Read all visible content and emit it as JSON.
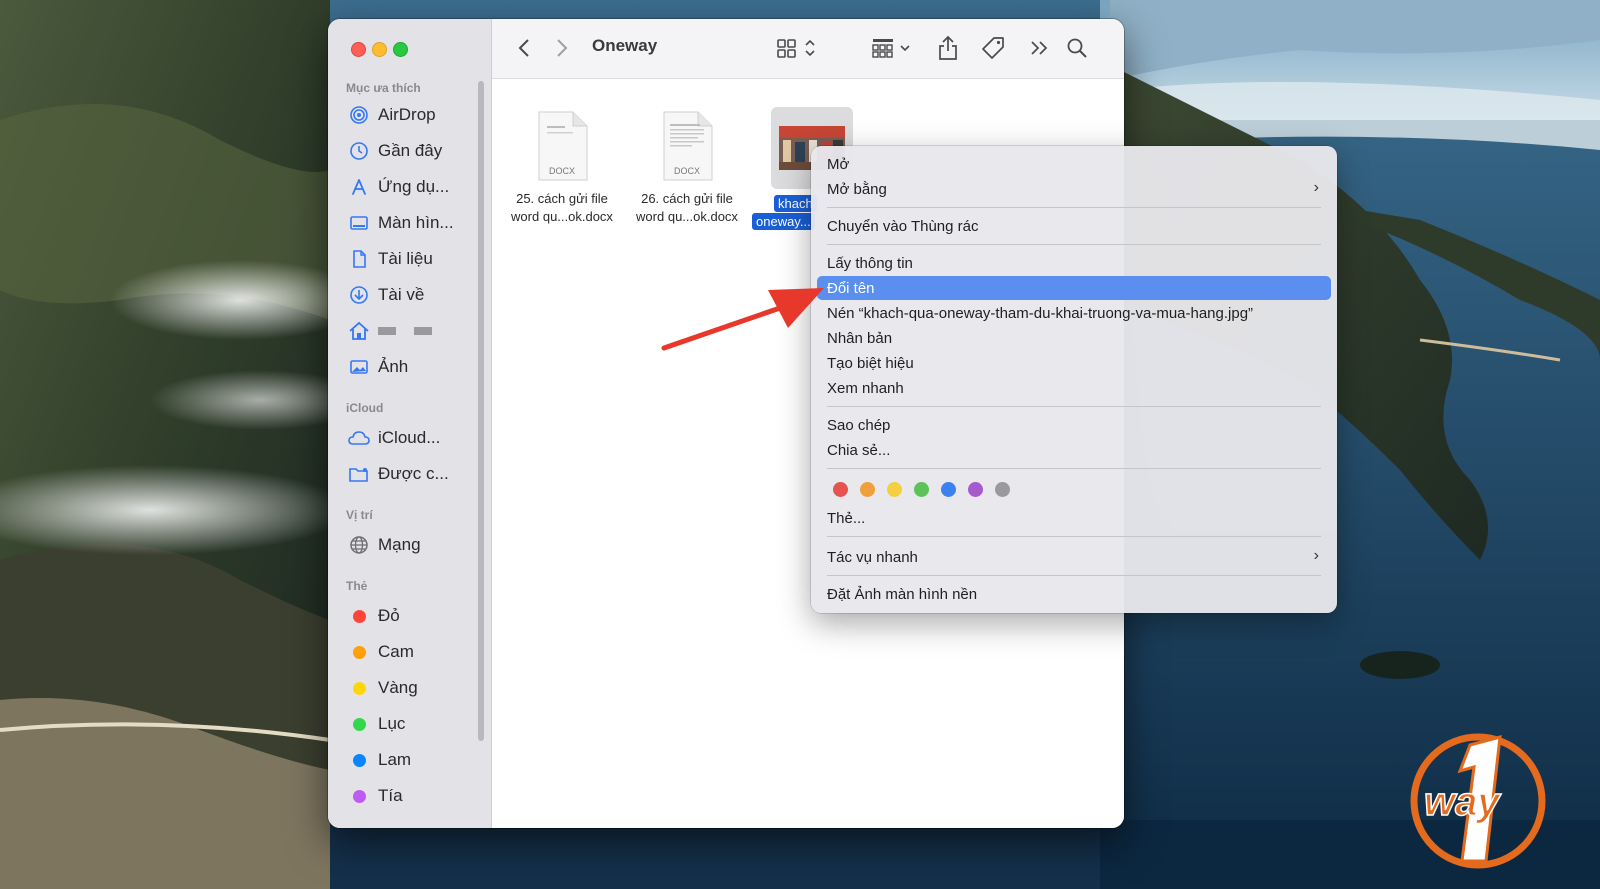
{
  "window": {
    "title": "Oneway"
  },
  "sidebar": {
    "sections": {
      "favorites": "Mục ưa thích",
      "icloud": "iCloud",
      "locations": "Vị trí",
      "tags": "Thẻ"
    },
    "favorites": [
      {
        "label": "AirDrop",
        "icon": "airdrop-icon"
      },
      {
        "label": "Gần đây",
        "icon": "clock-icon"
      },
      {
        "label": "Ứng dụ...",
        "icon": "applications-icon"
      },
      {
        "label": "Màn hìn...",
        "icon": "desktop-icon"
      },
      {
        "label": "Tài liệu",
        "icon": "document-icon"
      },
      {
        "label": "Tài về",
        "icon": "download-icon"
      },
      {
        "label": "",
        "icon": "home-icon"
      },
      {
        "label": "Ảnh",
        "icon": "photo-icon"
      }
    ],
    "icloud": [
      {
        "label": "iCloud...",
        "icon": "cloud-icon"
      },
      {
        "label": "Được c...",
        "icon": "shared-folder-icon"
      }
    ],
    "locations": [
      {
        "label": "Mạng",
        "icon": "globe-icon"
      }
    ],
    "tags": [
      {
        "label": "Đỏ",
        "color": "#ff453a"
      },
      {
        "label": "Cam",
        "color": "#ff9f0a"
      },
      {
        "label": "Vàng",
        "color": "#ffd60a"
      },
      {
        "label": "Lục",
        "color": "#32d74b"
      },
      {
        "label": "Lam",
        "color": "#0a84ff"
      },
      {
        "label": "Tía",
        "color": "#bf5af2"
      }
    ]
  },
  "files": [
    {
      "line1": "25. cách gửi file",
      "line2": "word qu...ok.docx",
      "type_label": "DOCX"
    },
    {
      "line1": "26. cách gửi file",
      "line2": "word qu...ok.docx",
      "type_label": "DOCX"
    },
    {
      "line1": "khach",
      "line2": "oneway...",
      "type_label": ""
    }
  ],
  "context_menu": {
    "open": "Mở",
    "open_with": "Mở bằng",
    "move_to_trash": "Chuyển vào Thùng rác",
    "get_info": "Lấy thông tin",
    "rename": "Đổi tên",
    "compress": "Nén “khach-qua-oneway-tham-du-khai-truong-va-mua-hang.jpg”",
    "duplicate": "Nhân bản",
    "make_alias": "Tạo biệt hiệu",
    "quick_look": "Xem nhanh",
    "copy": "Sao chép",
    "share": "Chia sẻ...",
    "tag_colors": [
      "#e5544e",
      "#f0a03a",
      "#f4cf3e",
      "#5cc35a",
      "#3b82f0",
      "#a65ad0",
      "#9a9a9e"
    ],
    "tags": "Thẻ...",
    "quick_actions": "Tác vụ nhanh",
    "set_desktop_picture": "Đặt Ảnh màn hình nền"
  },
  "colors": {
    "menu_highlight": "#5a8fef",
    "selection": "#1b5fd6",
    "arrow": "#e8372b",
    "logo_orange": "#e46a1d"
  }
}
